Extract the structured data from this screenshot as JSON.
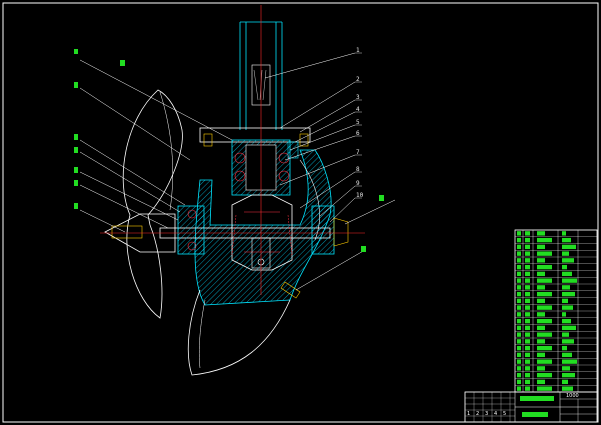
{
  "drawing": {
    "background": "#000000",
    "line_color": "#ffffff",
    "detail_color": "#00e5ff",
    "centerline_color": "#ff2a2a",
    "leader_color": "#ffffff",
    "tag_color": "#22dd22"
  },
  "part_numbers": [
    "1",
    "2",
    "3",
    "4",
    "5",
    "6",
    "7",
    "8",
    "9",
    "10"
  ],
  "title_block": {
    "drawing_no": "1000",
    "revision_marks": [
      "1",
      "2",
      "3",
      "4",
      "5"
    ]
  }
}
